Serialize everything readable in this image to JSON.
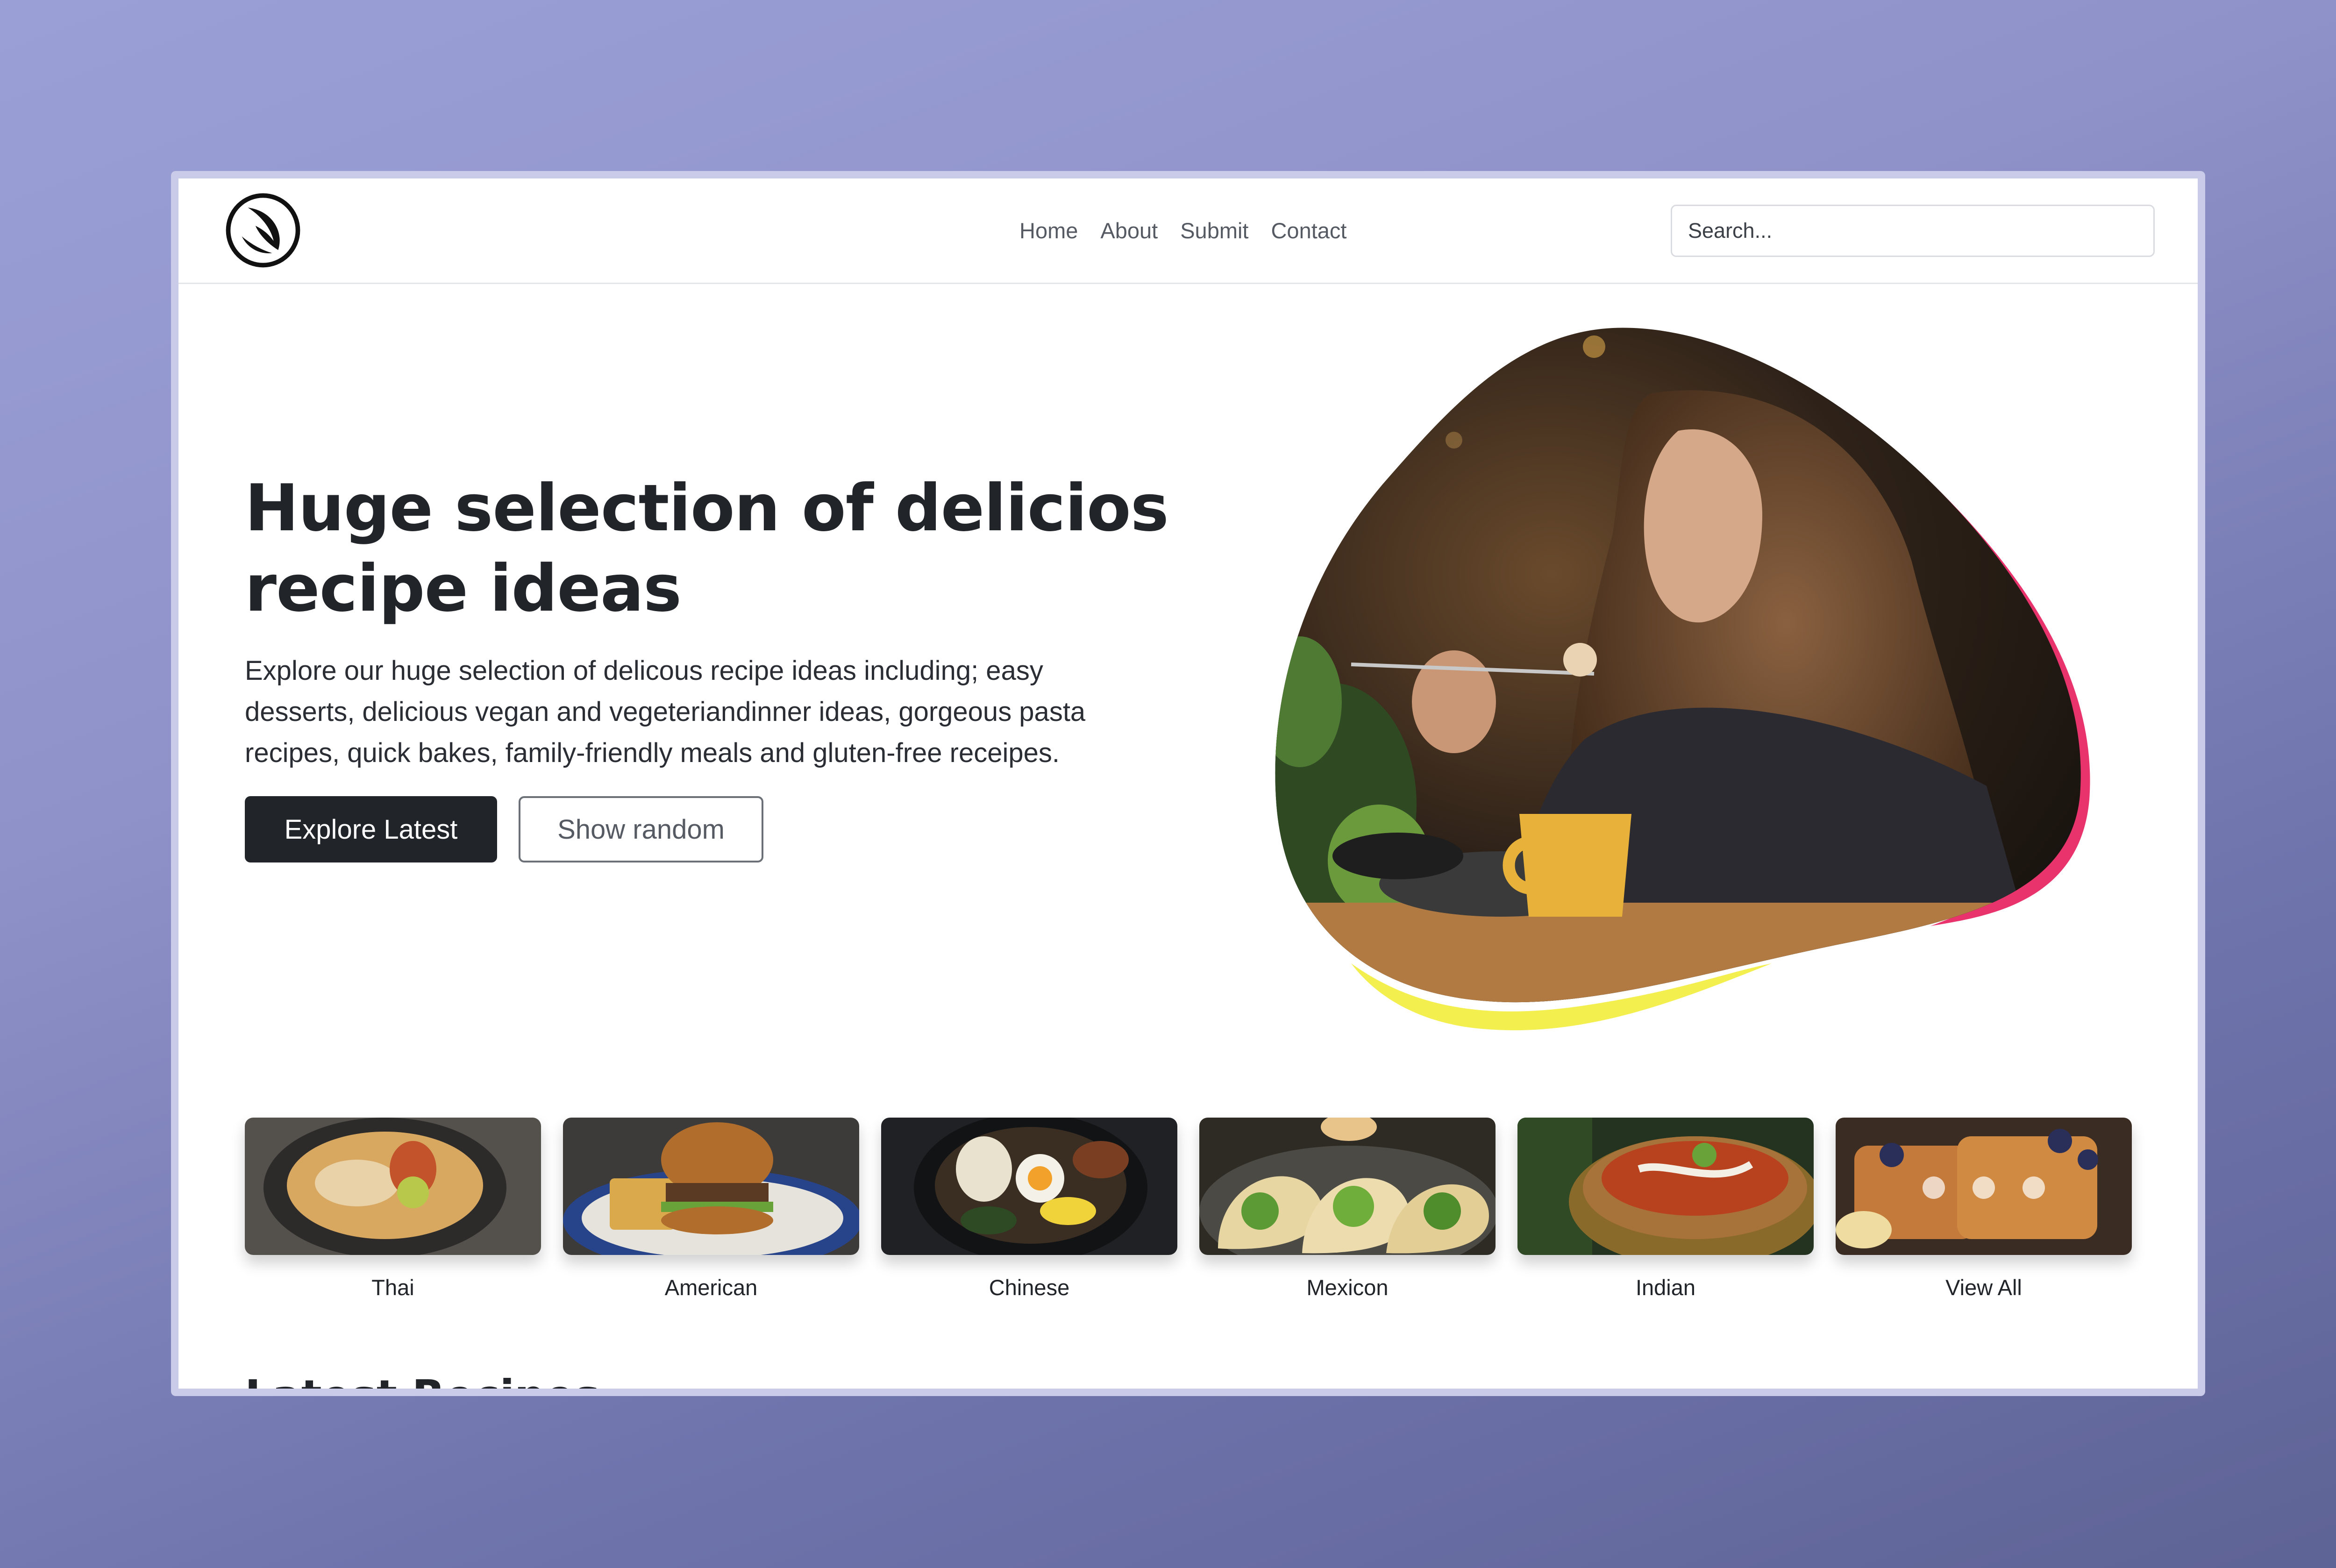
{
  "nav": {
    "items": [
      "Home",
      "About",
      "Submit",
      "Contact"
    ]
  },
  "search": {
    "placeholder": "Search..."
  },
  "hero": {
    "title": "Huge selection of delicios recipe ideas",
    "description": "Explore our huge selection of delicous recipe ideas including; easy desserts, delicious vegan and vegeteriandinner ideas, gorgeous pasta recipes, quick bakes, family-friendly meals and gluten-free receipes.",
    "primary_button": "Explore Latest",
    "secondary_button": "Show random"
  },
  "categories": [
    {
      "label": "Thai"
    },
    {
      "label": "American"
    },
    {
      "label": "Chinese"
    },
    {
      "label": "Mexicon"
    },
    {
      "label": "Indian"
    },
    {
      "label": "View All"
    }
  ],
  "next_section_title": "Latest Recipes",
  "colors": {
    "primary_button_bg": "#212529",
    "blob_accent_pink": "#e8336d",
    "blob_accent_yellow": "#f3ef4f",
    "background_gradient": "#8f92c8"
  }
}
